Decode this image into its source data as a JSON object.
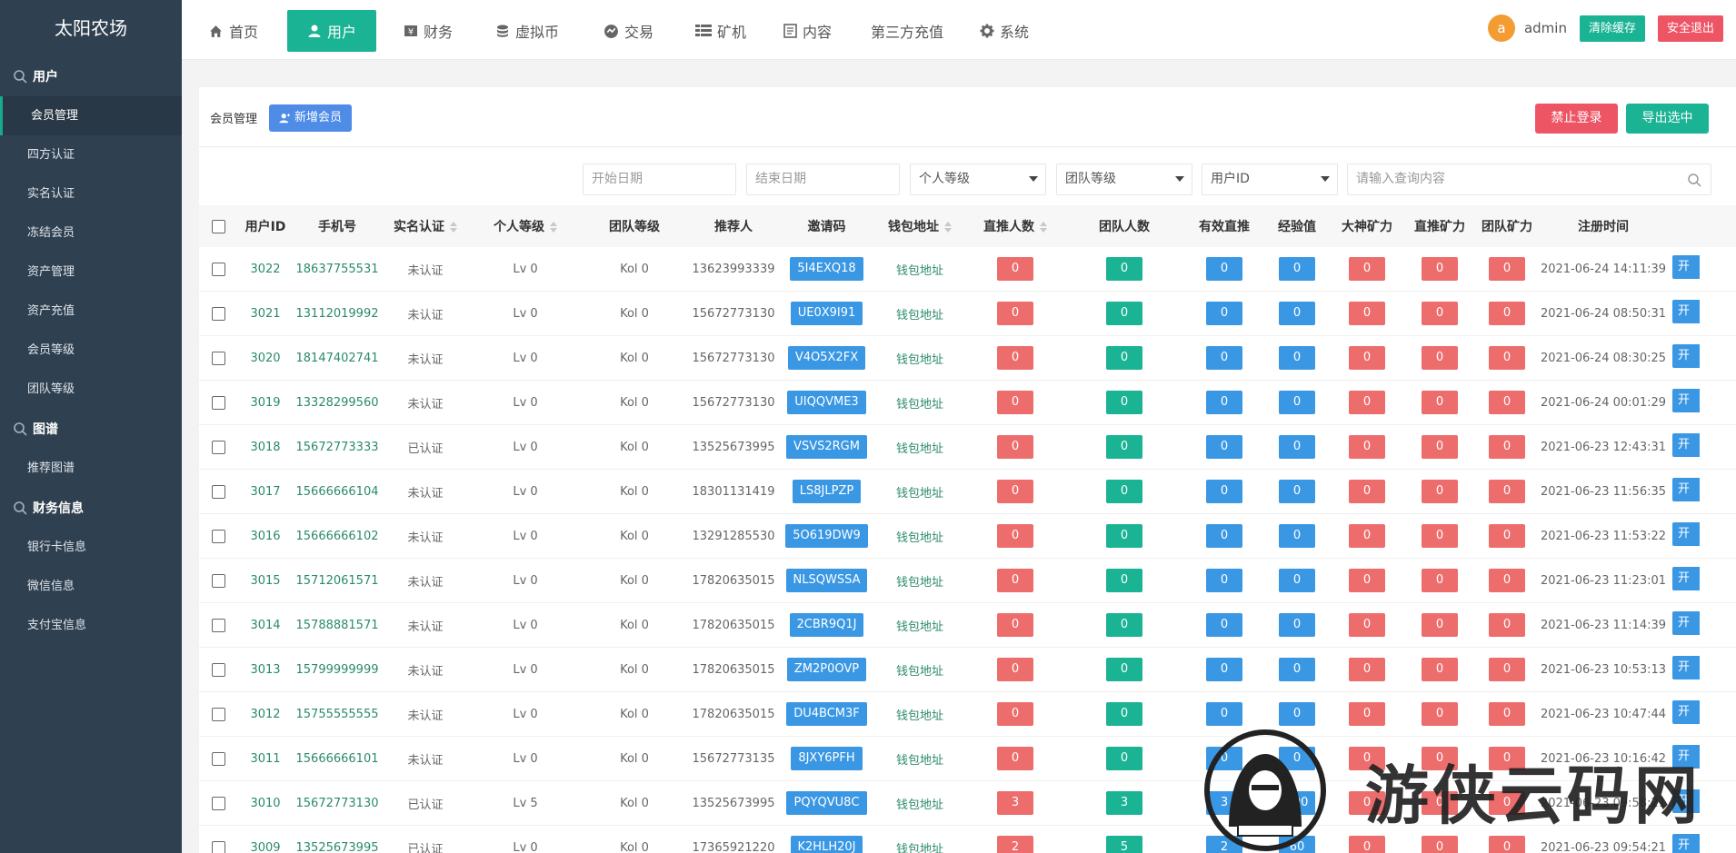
{
  "brand": "太阳农场",
  "sidebar": {
    "groups": [
      {
        "title": "用户",
        "items": [
          "会员管理",
          "四方认证",
          "实名认证",
          "冻结会员",
          "资产管理",
          "资产充值",
          "会员等级",
          "团队等级"
        ]
      },
      {
        "title": "图谱",
        "items": [
          "推荐图谱"
        ]
      },
      {
        "title": "财务信息",
        "items": [
          "银行卡信息",
          "微信信息",
          "支付宝信息"
        ]
      }
    ],
    "active_item": "会员管理"
  },
  "topnav": {
    "items": [
      {
        "label": "首页",
        "icon": "home-icon"
      },
      {
        "label": "用户",
        "icon": "user-icon",
        "active": true
      },
      {
        "label": "财务",
        "icon": "finance-icon"
      },
      {
        "label": "虚拟币",
        "icon": "coin-icon"
      },
      {
        "label": "交易",
        "icon": "trade-icon"
      },
      {
        "label": "矿机",
        "icon": "miner-icon"
      },
      {
        "label": "内容",
        "icon": "content-icon"
      },
      {
        "label": "第三方充值",
        "icon": ""
      },
      {
        "label": "系统",
        "icon": "gear-icon"
      }
    ],
    "avatar_letter": "a",
    "username": "admin",
    "clear_cache": "清除缓存",
    "logout": "安全退出"
  },
  "panel": {
    "title": "会员管理",
    "add_button": "新增会员",
    "ban_button": "禁止登录",
    "export_button": "导出选中"
  },
  "filters": {
    "start_date_placeholder": "开始日期",
    "end_date_placeholder": "结束日期",
    "personal_level": "个人等级",
    "team_level": "团队等级",
    "user_id": "用户ID",
    "query_placeholder": "请输入查询内容"
  },
  "table": {
    "headers": [
      "用户ID",
      "手机号",
      "实名认证",
      "个人等级",
      "团队等级",
      "推荐人",
      "邀请码",
      "钱包地址",
      "直推人数",
      "团队人数",
      "有效直推",
      "经验值",
      "大神矿力",
      "直推矿力",
      "团队矿力",
      "注册时间"
    ],
    "open_label": "开启",
    "wallet_label": "钱包地址",
    "rows": [
      {
        "id": "3022",
        "phone": "18637755531",
        "verified": "未认证",
        "level": "Lv 0",
        "team": "Kol 0",
        "referrer": "13623993339",
        "code": "5I4EXQ18",
        "direct": "0",
        "teamsize": "0",
        "valid": "0",
        "exp": "0",
        "god": "0",
        "dpower": "0",
        "tpower": "0",
        "time": "2021-06-24 14:11:39"
      },
      {
        "id": "3021",
        "phone": "13112019992",
        "verified": "未认证",
        "level": "Lv 0",
        "team": "Kol 0",
        "referrer": "15672773130",
        "code": "UE0X9I91",
        "direct": "0",
        "teamsize": "0",
        "valid": "0",
        "exp": "0",
        "god": "0",
        "dpower": "0",
        "tpower": "0",
        "time": "2021-06-24 08:50:31"
      },
      {
        "id": "3020",
        "phone": "18147402741",
        "verified": "未认证",
        "level": "Lv 0",
        "team": "Kol 0",
        "referrer": "15672773130",
        "code": "V4O5X2FX",
        "direct": "0",
        "teamsize": "0",
        "valid": "0",
        "exp": "0",
        "god": "0",
        "dpower": "0",
        "tpower": "0",
        "time": "2021-06-24 08:30:25"
      },
      {
        "id": "3019",
        "phone": "13328299560",
        "verified": "未认证",
        "level": "Lv 0",
        "team": "Kol 0",
        "referrer": "15672773130",
        "code": "UIQQVME3",
        "direct": "0",
        "teamsize": "0",
        "valid": "0",
        "exp": "0",
        "god": "0",
        "dpower": "0",
        "tpower": "0",
        "time": "2021-06-24 00:01:29"
      },
      {
        "id": "3018",
        "phone": "15672773333",
        "verified": "已认证",
        "level": "Lv 0",
        "team": "Kol 0",
        "referrer": "13525673995",
        "code": "VSVS2RGM",
        "direct": "0",
        "teamsize": "0",
        "valid": "0",
        "exp": "0",
        "god": "0",
        "dpower": "0",
        "tpower": "0",
        "time": "2021-06-23 12:43:31"
      },
      {
        "id": "3017",
        "phone": "15666666104",
        "verified": "未认证",
        "level": "Lv 0",
        "team": "Kol 0",
        "referrer": "18301131419",
        "code": "LS8JLPZP",
        "direct": "0",
        "teamsize": "0",
        "valid": "0",
        "exp": "0",
        "god": "0",
        "dpower": "0",
        "tpower": "0",
        "time": "2021-06-23 11:56:35"
      },
      {
        "id": "3016",
        "phone": "15666666102",
        "verified": "未认证",
        "level": "Lv 0",
        "team": "Kol 0",
        "referrer": "13291285530",
        "code": "5O619DW9",
        "direct": "0",
        "teamsize": "0",
        "valid": "0",
        "exp": "0",
        "god": "0",
        "dpower": "0",
        "tpower": "0",
        "time": "2021-06-23 11:53:22"
      },
      {
        "id": "3015",
        "phone": "15712061571",
        "verified": "未认证",
        "level": "Lv 0",
        "team": "Kol 0",
        "referrer": "17820635015",
        "code": "NLSQWSSA",
        "direct": "0",
        "teamsize": "0",
        "valid": "0",
        "exp": "0",
        "god": "0",
        "dpower": "0",
        "tpower": "0",
        "time": "2021-06-23 11:23:01"
      },
      {
        "id": "3014",
        "phone": "15788881571",
        "verified": "未认证",
        "level": "Lv 0",
        "team": "Kol 0",
        "referrer": "17820635015",
        "code": "2CBR9Q1J",
        "direct": "0",
        "teamsize": "0",
        "valid": "0",
        "exp": "0",
        "god": "0",
        "dpower": "0",
        "tpower": "0",
        "time": "2021-06-23 11:14:39"
      },
      {
        "id": "3013",
        "phone": "15799999999",
        "verified": "未认证",
        "level": "Lv 0",
        "team": "Kol 0",
        "referrer": "17820635015",
        "code": "ZM2P0OVP",
        "direct": "0",
        "teamsize": "0",
        "valid": "0",
        "exp": "0",
        "god": "0",
        "dpower": "0",
        "tpower": "0",
        "time": "2021-06-23 10:53:13"
      },
      {
        "id": "3012",
        "phone": "15755555555",
        "verified": "未认证",
        "level": "Lv 0",
        "team": "Kol 0",
        "referrer": "17820635015",
        "code": "DU4BCM3F",
        "direct": "0",
        "teamsize": "0",
        "valid": "0",
        "exp": "0",
        "god": "0",
        "dpower": "0",
        "tpower": "0",
        "time": "2021-06-23 10:47:44"
      },
      {
        "id": "3011",
        "phone": "15666666101",
        "verified": "未认证",
        "level": "Lv 0",
        "team": "Kol 0",
        "referrer": "15672773135",
        "code": "8JXY6PFH",
        "direct": "0",
        "teamsize": "0",
        "valid": "0",
        "exp": "0",
        "god": "0",
        "dpower": "0",
        "tpower": "0",
        "time": "2021-06-23 10:16:42"
      },
      {
        "id": "3010",
        "phone": "15672773130",
        "verified": "已认证",
        "level": "Lv 5",
        "team": "Kol 0",
        "referrer": "13525673995",
        "code": "PQYQVU8C",
        "direct": "3",
        "teamsize": "3",
        "valid": "3",
        "exp": "300",
        "god": "0",
        "dpower": "0",
        "tpower": "0",
        "time": "2021-06-23 09:58:21"
      },
      {
        "id": "3009",
        "phone": "13525673995",
        "verified": "已认证",
        "level": "Lv 0",
        "team": "Kol 0",
        "referrer": "17365921220",
        "code": "K2HLH20J",
        "direct": "2",
        "teamsize": "5",
        "valid": "2",
        "exp": "60",
        "god": "0",
        "dpower": "0",
        "tpower": "0",
        "time": "2021-06-23 09:54:21"
      }
    ]
  },
  "watermark": "游侠云码网",
  "colors": {
    "primary": "#1ab394",
    "danger": "#ed5565",
    "info": "#3a97e4",
    "sidebar": "#2f4050"
  }
}
